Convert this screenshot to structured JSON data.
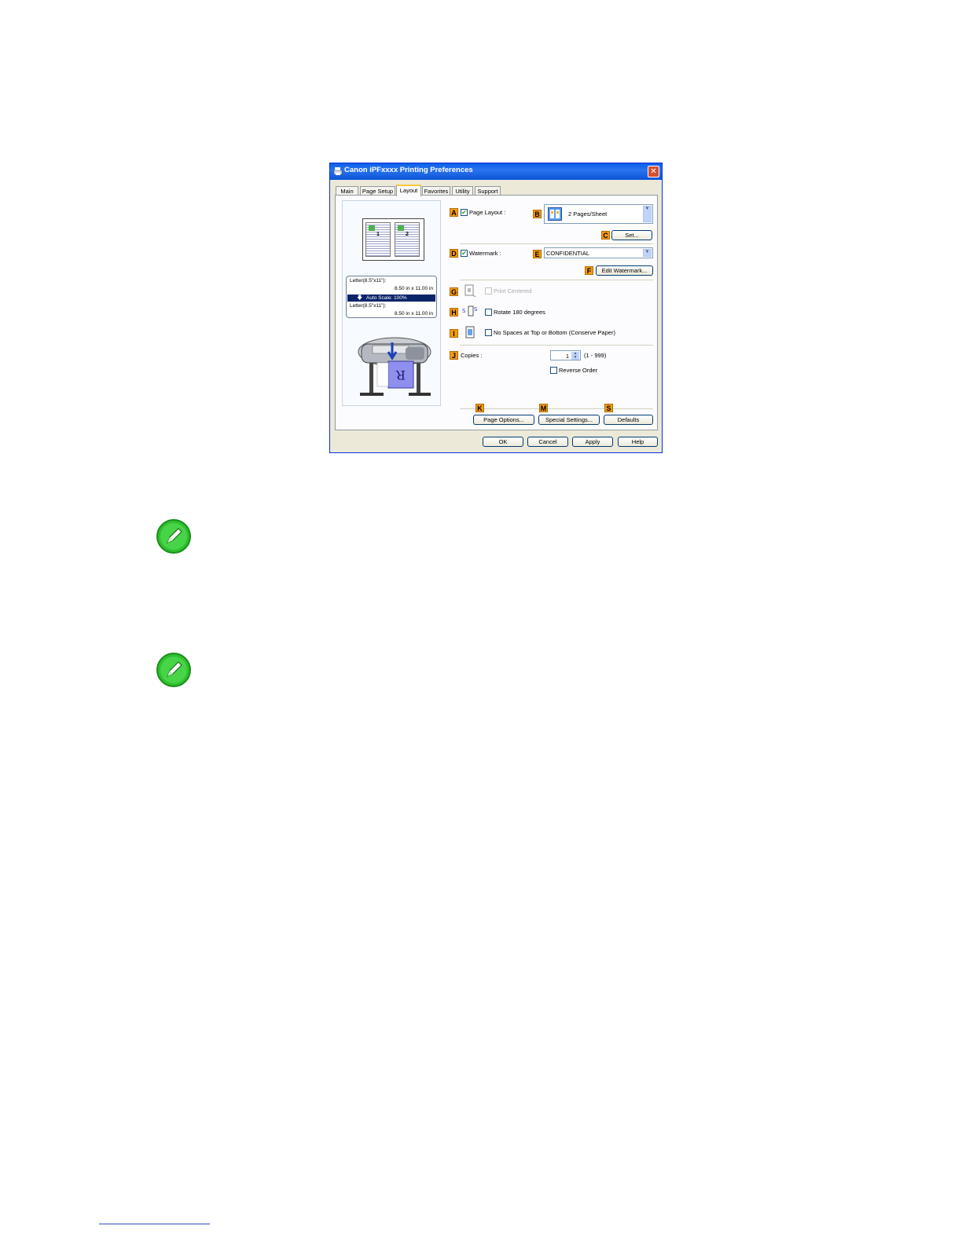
{
  "window": {
    "title": "Canon iPFxxxx Printing Preferences",
    "close_glyph": "✕"
  },
  "tabs": [
    {
      "label": "Main"
    },
    {
      "label": "Page Setup"
    },
    {
      "label": "Layout",
      "active": true
    },
    {
      "label": "Favorites"
    },
    {
      "label": "Utility"
    },
    {
      "label": "Support"
    }
  ],
  "preview": {
    "page_numbers": [
      "1",
      "2"
    ],
    "source_size": "Letter(8.5\"x11\"):",
    "source_dims": "8.50 in x 11.00 in",
    "scale": "Auto Scale: 100%",
    "output_size": "Letter(8.5\"x11\"):",
    "output_dims": "8.50 in x 11.00 in"
  },
  "layout": {
    "page_layout": {
      "badge": "A",
      "label": "Page Layout :",
      "checked": true
    },
    "pages_select": {
      "badge": "B",
      "value": "2 Pages/Sheet"
    },
    "set_button": {
      "badge": "C",
      "label": "Set..."
    },
    "watermark": {
      "badge": "D",
      "label": "Watermark :",
      "checked": true
    },
    "watermark_select": {
      "badge": "E",
      "value": "CONFIDENTIAL"
    },
    "edit_watermark": {
      "badge": "F",
      "label": "Edit Watermark..."
    },
    "print_centered": {
      "badge": "G",
      "label": "Print Centered",
      "checked": false,
      "disabled": true
    },
    "rotate": {
      "badge": "H",
      "label": "Rotate 180 degrees",
      "checked": false
    },
    "no_spaces": {
      "badge": "I",
      "label": "No Spaces at Top or Bottom (Conserve Paper)",
      "checked": false
    },
    "copies": {
      "badge": "J",
      "label": "Copies :",
      "value": "1",
      "range": "(1 - 999)"
    },
    "reverse_order": {
      "label": "Reverse Order",
      "checked": false
    },
    "page_options": {
      "badge": "K",
      "label": "Page Options..."
    },
    "special_settings": {
      "badge": "M",
      "label": "Special Settings..."
    },
    "defaults": {
      "badge": "S",
      "label": "Defaults"
    }
  },
  "footer_buttons": {
    "ok": "OK",
    "cancel": "Cancel",
    "apply": "Apply",
    "help": "Help"
  },
  "colors": {
    "title_bar": "#0a5fe8",
    "badge": "#f59a0e",
    "note_icon": "#2fbf2f"
  },
  "icons": {
    "note": "pencil-note-icon"
  }
}
